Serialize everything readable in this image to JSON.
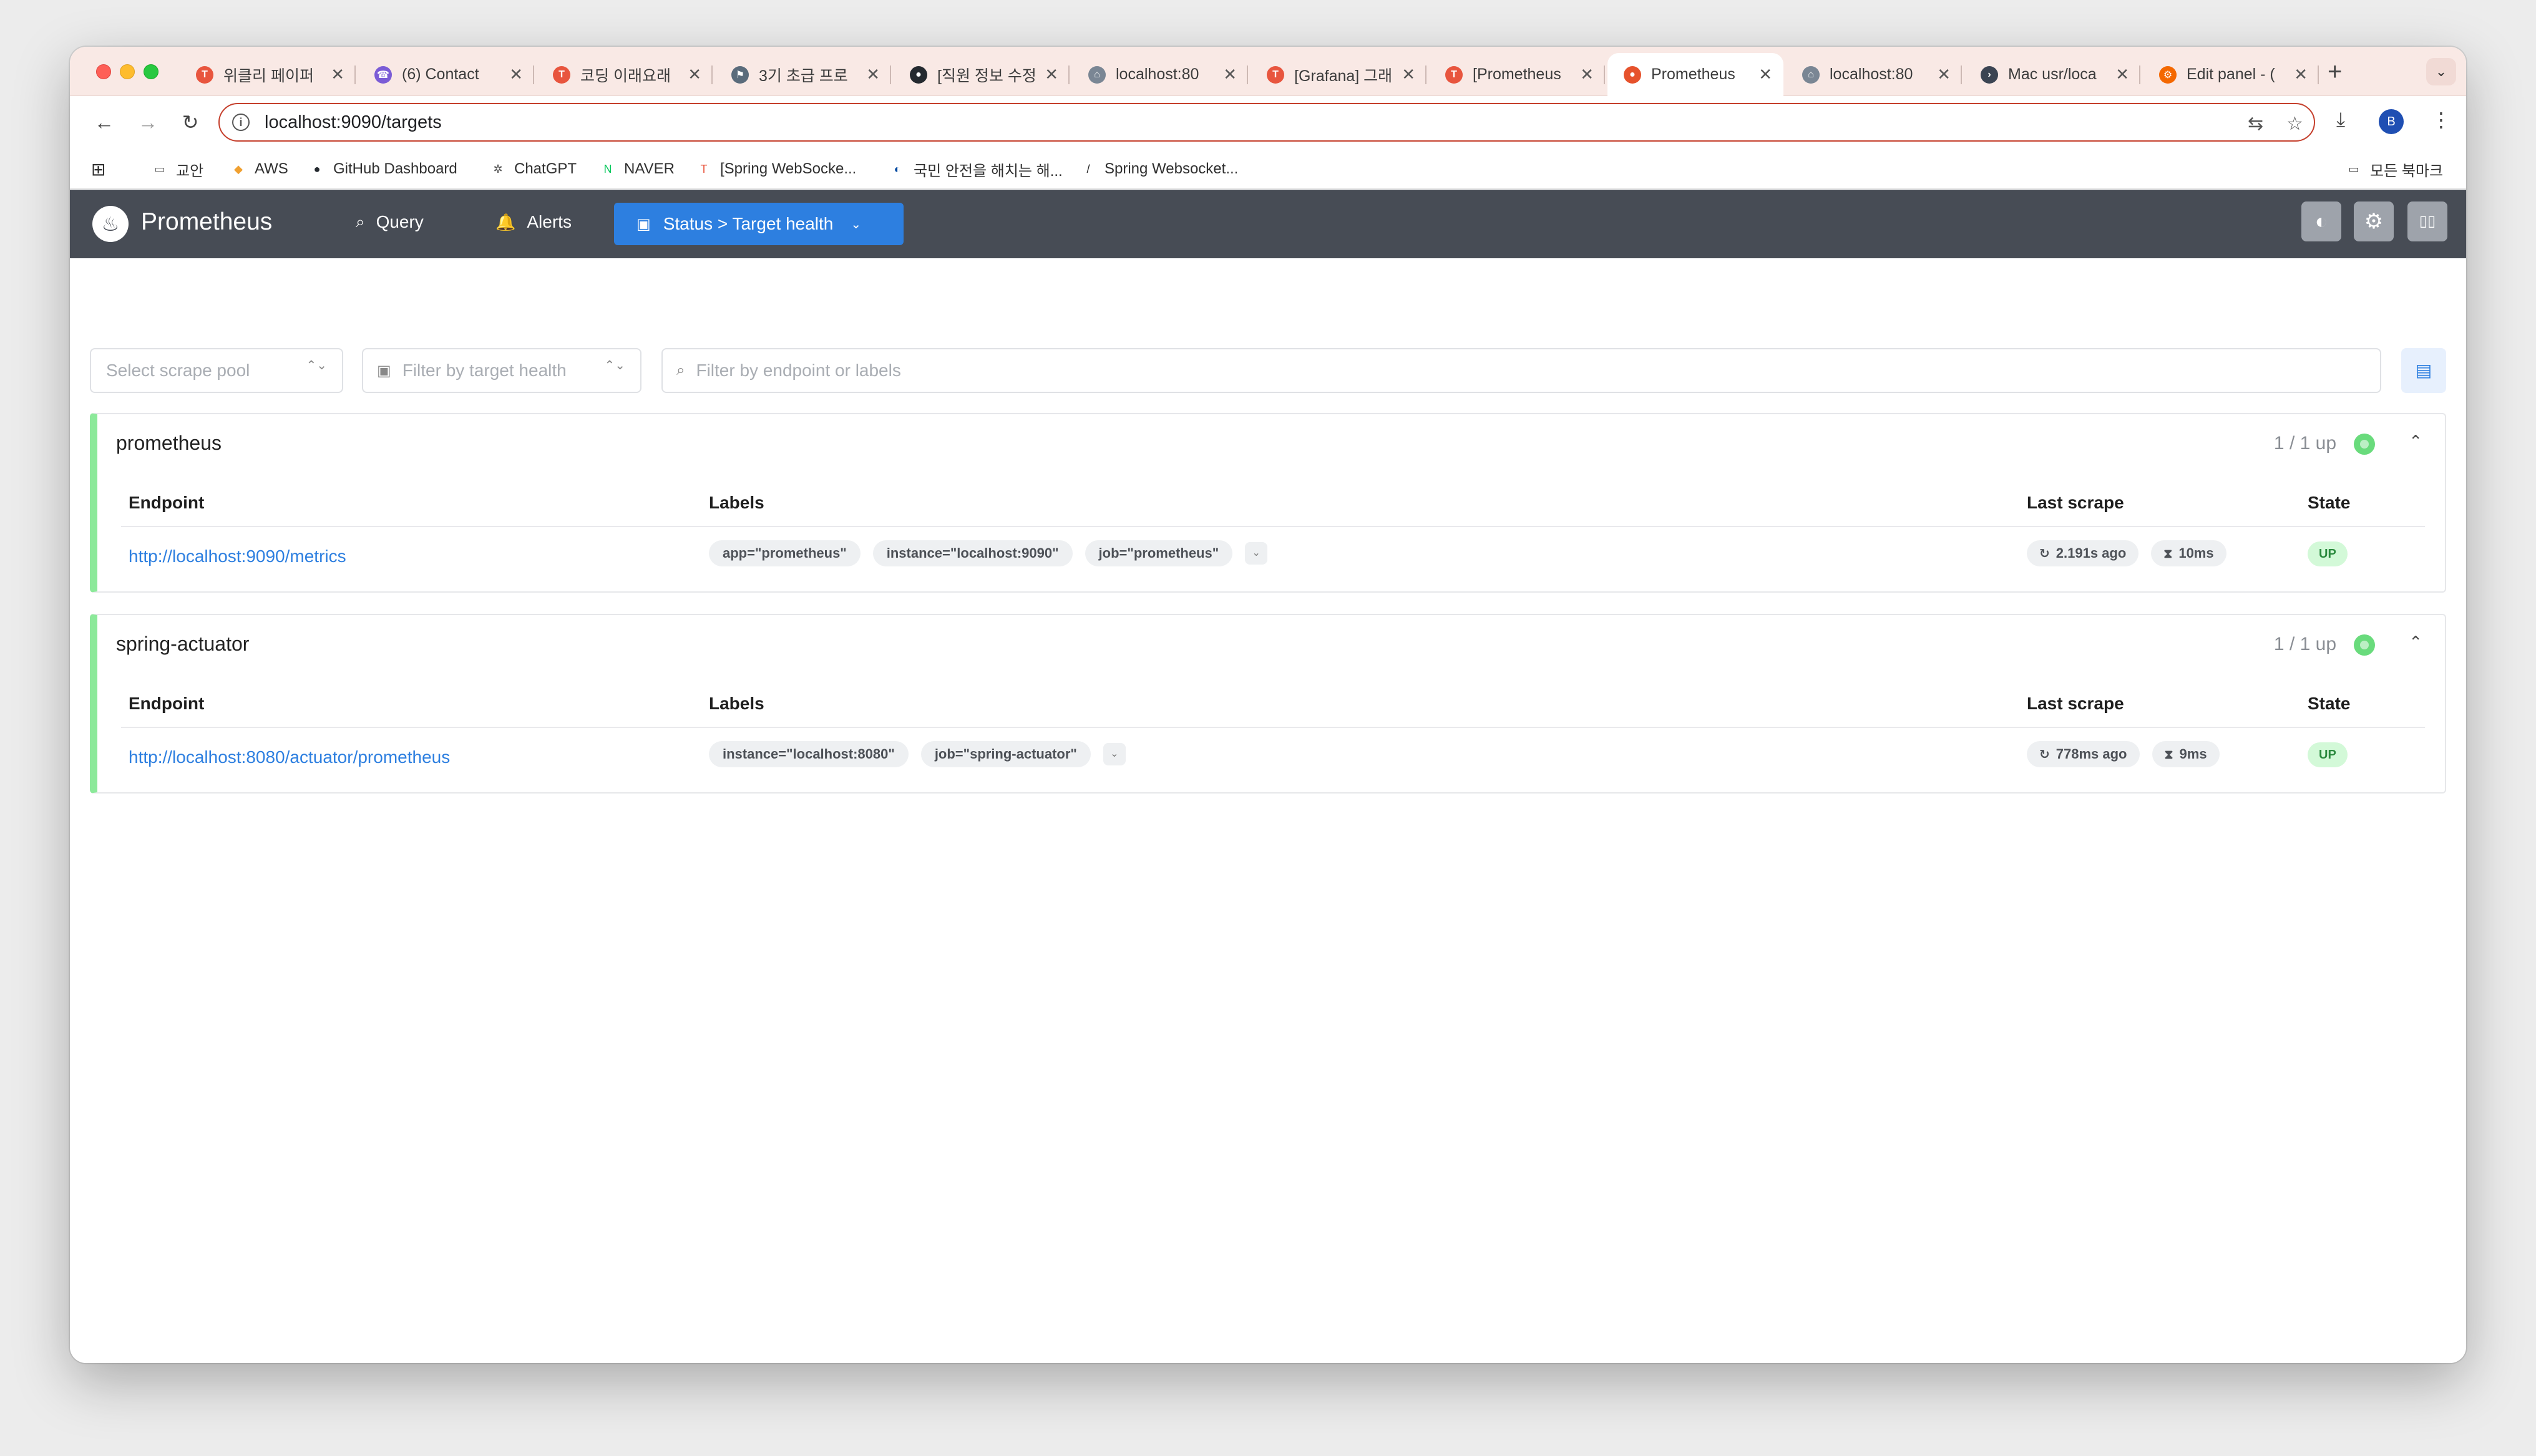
{
  "browser": {
    "tabs": [
      {
        "title": "위클리 페이퍼",
        "favicon": "velog-icon",
        "color": "#e8553e",
        "glyph": "T"
      },
      {
        "title": "(6) Contact",
        "favicon": "viber-icon",
        "color": "#7b5cd6",
        "glyph": "☎"
      },
      {
        "title": "코딩 이래요래",
        "favicon": "velog-icon",
        "color": "#e8553e",
        "glyph": "T"
      },
      {
        "title": "3기 초급 프로",
        "favicon": "flag-icon",
        "color": "#5a6b7b",
        "glyph": "⚑"
      },
      {
        "title": "[직원 정보 수정",
        "favicon": "github-icon",
        "color": "#24292f",
        "glyph": "●"
      },
      {
        "title": "localhost:80",
        "favicon": "bank-icon",
        "color": "#7a8694",
        "glyph": "⌂"
      },
      {
        "title": "[Grafana] 그래",
        "favicon": "velog-icon",
        "color": "#e8553e",
        "glyph": "T"
      },
      {
        "title": "[Prometheus",
        "favicon": "velog-icon",
        "color": "#e8553e",
        "glyph": "T"
      },
      {
        "title": "Prometheus",
        "favicon": "prometheus-icon",
        "color": "#e6522c",
        "glyph": "●",
        "active": true
      },
      {
        "title": "localhost:80",
        "favicon": "bank-icon",
        "color": "#7a8694",
        "glyph": "⌂"
      },
      {
        "title": "Mac usr/loca",
        "favicon": "terminal-icon",
        "color": "#3b4452",
        "glyph": "›"
      },
      {
        "title": "Edit panel - (",
        "favicon": "grafana-icon",
        "color": "#f46800",
        "glyph": "⚙"
      }
    ],
    "close_glyph": "✕",
    "new_tab_glyph": "+",
    "tab_menu_glyph": "⌄",
    "nav": {
      "back": "←",
      "forward": "→",
      "reload": "↻"
    },
    "url": "localhost:9090/targets",
    "info_glyph": "i",
    "translate_glyph": "⇆",
    "star_glyph": "☆",
    "download_glyph": "⤓",
    "profile_initial": "B",
    "menu_glyph": "⋮",
    "bookmarks_grid_glyph": "⊞",
    "bookmarks": [
      {
        "label": "교안",
        "icon": "folder-icon",
        "glyph": "▭"
      },
      {
        "label": "AWS",
        "icon": "aws-icon",
        "glyph": "◆"
      },
      {
        "label": "GitHub Dashboard",
        "icon": "github-icon",
        "glyph": "●"
      },
      {
        "label": "ChatGPT",
        "icon": "chatgpt-icon",
        "glyph": "✲"
      },
      {
        "label": "NAVER",
        "icon": "naver-icon",
        "glyph": "N"
      },
      {
        "label": "[Spring WebSocke...",
        "icon": "velog-icon",
        "glyph": "T"
      },
      {
        "label": "국민 안전을 해치는 해...",
        "icon": "korea-flag-icon",
        "glyph": "◐"
      },
      {
        "label": "Spring Websocket...",
        "icon": "notion-icon",
        "glyph": "/"
      }
    ],
    "all_bookmarks": {
      "label": "모든 북마크",
      "glyph": "▭"
    }
  },
  "prometheus": {
    "brand": "Prometheus",
    "logo_glyph": "♨",
    "nav": {
      "query": {
        "label": "Query",
        "glyph": "⌕"
      },
      "alerts": {
        "label": "Alerts",
        "glyph": "🔔"
      },
      "status": {
        "label": "Status > Target health",
        "glyph": "▣",
        "chevron": "⌄"
      }
    },
    "buttons": {
      "theme": "◐",
      "settings": "⚙",
      "docs": "▯▯"
    },
    "filters": {
      "scrape_pool_placeholder": "Select scrape pool",
      "target_health_placeholder": "Filter by target health",
      "endpoint_placeholder": "Filter by endpoint or labels",
      "updown_glyph": "⌃⌄",
      "health_glyph": "▣",
      "search_glyph": "⌕",
      "layout_glyph": "▤"
    },
    "columns": {
      "endpoint": "Endpoint",
      "labels": "Labels",
      "last_scrape": "Last scrape",
      "state": "State"
    },
    "pools": [
      {
        "name": "prometheus",
        "up_summary": "1 / 1 up",
        "collapse_glyph": "⌃",
        "target": {
          "endpoint": "http://localhost:9090/metrics",
          "labels": [
            "app=\"prometheus\"",
            "instance=\"localhost:9090\"",
            "job=\"prometheus\""
          ],
          "more_glyph": "⌄",
          "last_scrape": "2.191s ago",
          "duration": "10ms",
          "state": "UP"
        }
      },
      {
        "name": "spring-actuator",
        "up_summary": "1 / 1 up",
        "collapse_glyph": "⌃",
        "target": {
          "endpoint": "http://localhost:8080/actuator/prometheus",
          "labels": [
            "instance=\"localhost:8080\"",
            "job=\"spring-actuator\""
          ],
          "more_glyph": "⌄",
          "last_scrape": "778ms ago",
          "duration": "9ms",
          "state": "UP"
        }
      }
    ],
    "refresh_glyph": "↻",
    "timer_glyph": "⧗"
  },
  "colors": {
    "tab_strip": "#f9e9e5",
    "omnibox_border": "#c53f2c",
    "navbar": "#474c55",
    "accent": "#2d7fe0",
    "pool_border": "#8ce99a",
    "up_dot": "#69db7c",
    "state_badge_bg": "#d3f9d8",
    "state_badge_text": "#2b8a3e"
  }
}
